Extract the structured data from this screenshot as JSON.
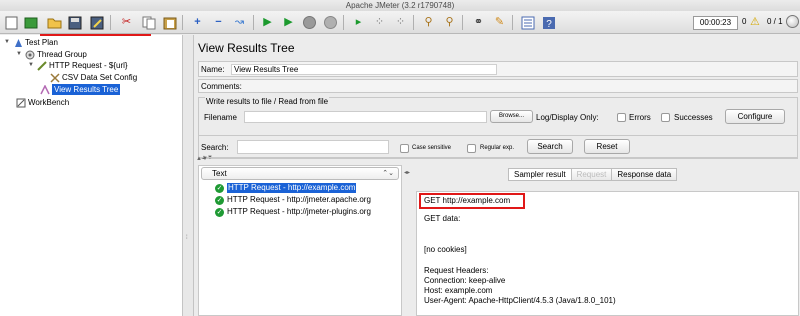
{
  "window": {
    "title": "Apache JMeter (3.2 r1790748)"
  },
  "toolbar": {
    "buttons": [
      "new-icon",
      "templates-icon",
      "open-icon",
      "save-icon",
      "save-as-icon",
      "cut-icon",
      "copy-icon",
      "paste-icon",
      "expand-icon",
      "collapse-icon",
      "toggle-icon",
      "start-icon",
      "start-no-timers-icon",
      "stop-icon",
      "shutdown-icon",
      "remote-start-icon",
      "remote-stop-icon",
      "remote-shutdown-icon",
      "clear-icon",
      "clear-all-icon",
      "search-icon",
      "reset-search-icon",
      "function-helper-icon",
      "help-icon"
    ],
    "timer": "00:00:23",
    "warnings": "0",
    "threads": "0 / 1"
  },
  "tree": {
    "nodes": [
      {
        "label": "Test Plan",
        "icon": "test-plan-icon"
      },
      {
        "label": "Thread Group",
        "icon": "thread-group-icon"
      },
      {
        "label": "HTTP Request - ${url}",
        "icon": "sampler-icon"
      },
      {
        "label": "CSV Data Set Config",
        "icon": "config-icon"
      },
      {
        "label": "View Results Tree",
        "icon": "listener-icon"
      },
      {
        "label": "WorkBench",
        "icon": "workbench-icon"
      }
    ]
  },
  "panel": {
    "title": "View Results Tree",
    "name_label": "Name:",
    "name_value": "View Results Tree",
    "comments_label": "Comments:",
    "write_legend": "Write results to file / Read from file",
    "filename_label": "Filename",
    "browse_label": "Browse...",
    "logdisplay_label": "Log/Display Only:",
    "errors_label": "Errors",
    "successes_label": "Successes",
    "configure_label": "Configure",
    "search_label": "Search:",
    "case_label": "Case sensitive",
    "regex_label": "Regular exp.",
    "search_button": "Search",
    "reset_button": "Reset"
  },
  "results": {
    "renderer": "Text",
    "items": [
      "HTTP Request - http://example.com",
      "HTTP Request - http://jmeter.apache.org",
      "HTTP Request - http://jmeter-plugins.org"
    ]
  },
  "detail": {
    "tabs": [
      "Sampler result",
      "Request",
      "Response data"
    ],
    "lines": [
      "GET http://example.com",
      "GET data:",
      "[no cookies]",
      "Request Headers:",
      "Connection: keep-alive",
      "Host: example.com",
      "User-Agent: Apache-HttpClient/4.5.3 (Java/1.8.0_101)"
    ]
  }
}
